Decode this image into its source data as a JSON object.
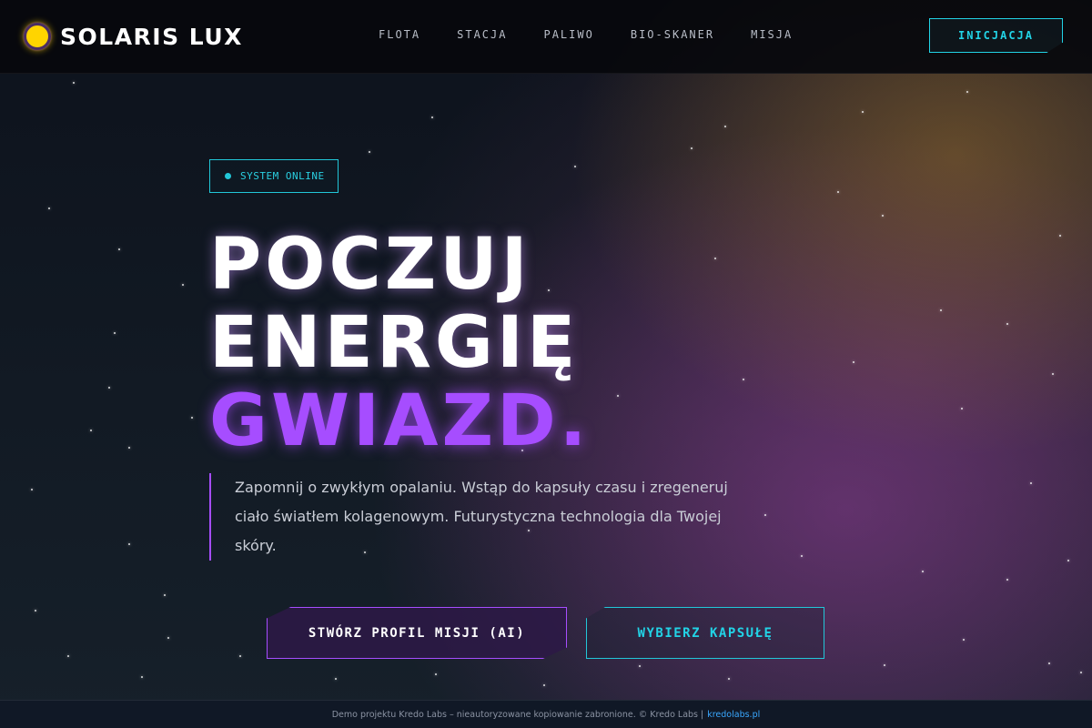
{
  "brand": {
    "name": "SOLARIS LUX",
    "logo_icon": "sun-icon"
  },
  "nav": {
    "items": [
      {
        "label": "FLOTA"
      },
      {
        "label": "STACJA"
      },
      {
        "label": "PALIWO"
      },
      {
        "label": "BIO-SKANER"
      },
      {
        "label": "MISJA"
      }
    ],
    "cta_label": "INICJACJA"
  },
  "hero": {
    "status": "SYSTEM ONLINE",
    "headline_line1": "POCZUJ",
    "headline_line2": "ENERGIĘ",
    "headline_accent": "GWIAZD.",
    "description": "Zapomnij o zwykłym opalaniu. Wstąp do kapsuły czasu i zregeneruj ciało światłem kolagenowym. Futurystyczna technologia dla Twojej skóry.",
    "primary_button": "STWÓRZ PROFIL MISJI (AI)",
    "secondary_button": "WYBIERZ KAPSUŁĘ"
  },
  "footer": {
    "text": "Demo projektu Kredo Labs – nieautoryzowane kopiowanie zabronione. © Kredo Labs |",
    "link": "kredolabs.pl"
  },
  "colors": {
    "accent_purple": "#a64dff",
    "accent_cyan": "#22d3e6",
    "sun_yellow": "#ffd400",
    "link_blue": "#3aa8ff"
  }
}
